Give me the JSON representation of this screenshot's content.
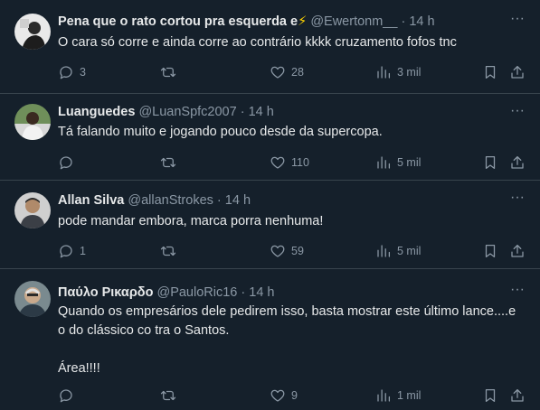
{
  "tweets": [
    {
      "display_name": "Pena que o rato cortou pra esquerda e",
      "emoji": "⚡",
      "handle": "@Ewertonm__",
      "time": "14 h",
      "text": [
        "O cara só corre e ainda corre ao contrário kkkk cruzamento fofos tnc"
      ],
      "replies": "3",
      "retweets": "",
      "likes": "28",
      "views": "3 mil"
    },
    {
      "display_name": "Luanguedes",
      "handle": "@LuanSpfc2007",
      "time": "14 h",
      "text": [
        "Tá falando muito e jogando pouco desde da supercopa."
      ],
      "replies": "",
      "retweets": "",
      "likes": "110",
      "views": "5 mil"
    },
    {
      "display_name": "Allan Silva",
      "handle": "@allanStrokes",
      "time": "14 h",
      "text": [
        "pode mandar embora, marca porra nenhuma!"
      ],
      "replies": "1",
      "retweets": "",
      "likes": "59",
      "views": "5 mil"
    },
    {
      "display_name": "Παύλο Ρικαρδο",
      "handle": "@PauloRic16",
      "time": "14 h",
      "text": [
        "Quando os empresários dele pedirem isso, basta mostrar este último lance....e",
        "o do clássico co tra o Santos.",
        "",
        "Área!!!!"
      ],
      "replies": "",
      "retweets": "",
      "likes": "9",
      "views": "1 mil"
    }
  ],
  "ui": {
    "separator": "·",
    "more_glyph": "···"
  },
  "colors": {
    "background": "#15202b",
    "text": "#e7e9ea",
    "muted": "#8b98a5",
    "divider": "#38444d"
  }
}
